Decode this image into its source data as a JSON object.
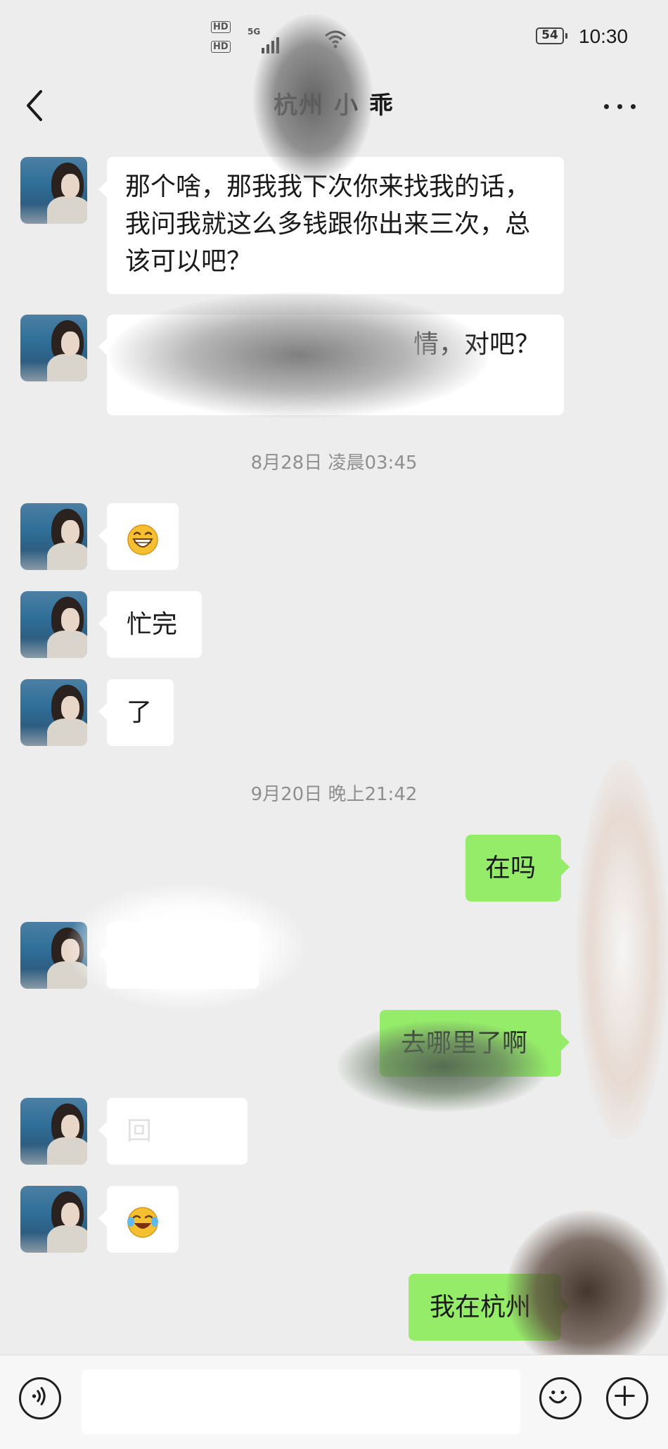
{
  "status_bar": {
    "hd1": "HD",
    "hd2": "HD",
    "network": "5G",
    "battery": "54",
    "time": "10:30"
  },
  "nav": {
    "title": "杭州 小 乖"
  },
  "messages": [
    {
      "side": "left",
      "text": "那个啥，那我我下次你来找我的话，我问我就这么多钱跟你出来三次，总该可以吧？"
    },
    {
      "side": "left",
      "text": "情，对吧？"
    },
    {
      "type": "timestamp",
      "text": "8月28日 凌晨03:45"
    },
    {
      "side": "left",
      "emoji": "grinning-face"
    },
    {
      "side": "left",
      "text": "忙完"
    },
    {
      "side": "left",
      "text": "了"
    },
    {
      "type": "timestamp",
      "text": "9月20日 晚上21:42"
    },
    {
      "side": "right",
      "text": "在吗"
    },
    {
      "side": "left",
      "text": ""
    },
    {
      "side": "right",
      "text": "去哪里了啊"
    },
    {
      "side": "left",
      "text": "回"
    },
    {
      "side": "left",
      "emoji": "face-with-tears-of-joy"
    },
    {
      "side": "right",
      "text": "我在杭州"
    }
  ],
  "input_bar": {
    "voice_icon": "voice-icon",
    "emoji_icon": "smile-icon",
    "plus_icon": "plus-icon",
    "value": ""
  },
  "colors": {
    "background": "#ededed",
    "bubble_incoming": "#ffffff",
    "bubble_outgoing": "#95ec69",
    "timestamp": "#8f8f8f"
  }
}
